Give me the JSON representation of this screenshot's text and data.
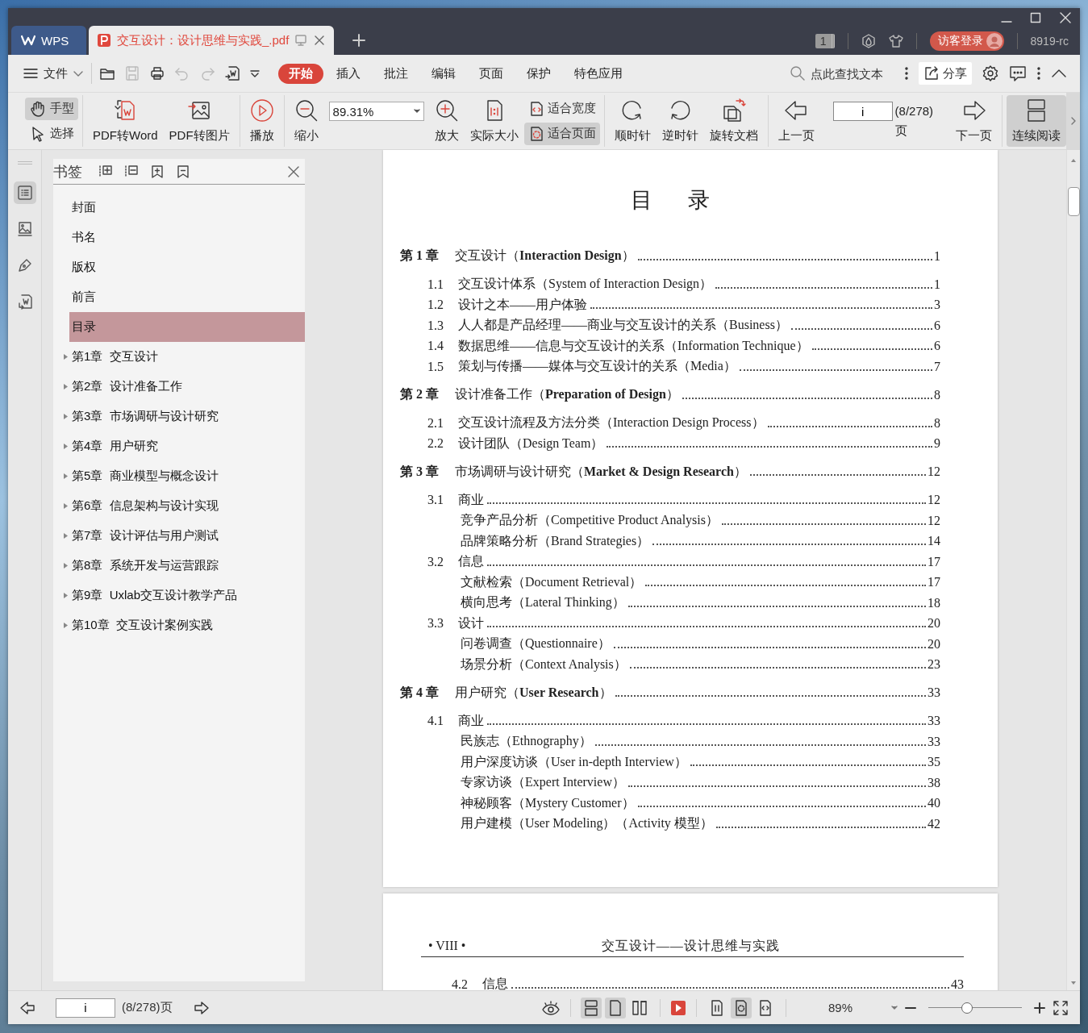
{
  "tabs": [
    {
      "kind": "home",
      "label": "WPS",
      "selected": false
    },
    {
      "kind": "document",
      "label": "交互设计：设计思维与实践_.pdf",
      "selected": true
    }
  ],
  "title_bar": {
    "badge": "1",
    "login_button": "访客登录",
    "user": "8919-rc"
  },
  "menu_bar": {
    "file_menu": "文件",
    "quick_access": [
      {
        "disabled": false
      },
      {
        "disabled": true
      },
      {
        "disabled": false
      },
      {
        "disabled": true
      },
      {
        "disabled": true
      },
      {
        "disabled": false
      }
    ],
    "tabs": [
      {
        "label": "开始",
        "selected": true
      },
      {
        "label": "插入",
        "selected": false
      },
      {
        "label": "批注",
        "selected": false
      },
      {
        "label": "编辑",
        "selected": false
      },
      {
        "label": "页面",
        "selected": false
      },
      {
        "label": "保护",
        "selected": false
      },
      {
        "label": "特色应用",
        "selected": false
      }
    ],
    "search": {
      "placeholder": "点此查找文本"
    },
    "share_button": "分享"
  },
  "toolbar": {
    "groups": [
      [
        {
          "kind": "pair",
          "buttons": [
            {
              "label": "手型",
              "selected": true
            },
            {
              "label": "选择",
              "selected": false
            }
          ]
        }
      ],
      [
        {
          "kind": "button",
          "label": "PDF转Word"
        },
        {
          "kind": "button",
          "label": "PDF转图片"
        }
      ],
      [
        {
          "kind": "button",
          "label": "播放"
        }
      ],
      [
        {
          "kind": "button",
          "label": "缩小"
        },
        {
          "kind": "zoom",
          "value": "89.31%"
        },
        {
          "kind": "button",
          "label": "放大"
        },
        {
          "kind": "button",
          "label": "实际大小"
        },
        {
          "kind": "pair",
          "buttons": [
            {
              "label": "适合宽度",
              "selected": false
            },
            {
              "label": "适合页面",
              "selected": true
            }
          ]
        }
      ],
      [
        {
          "kind": "button",
          "label": "顺时针"
        },
        {
          "kind": "button",
          "label": "逆时针"
        },
        {
          "kind": "button",
          "label": "旋转文档"
        }
      ],
      [
        {
          "kind": "button",
          "label": "上一页"
        },
        {
          "kind": "page",
          "value": "i",
          "total": "(8/278)页"
        },
        {
          "kind": "button",
          "label": "下一页"
        }
      ],
      [
        {
          "kind": "toggle",
          "label": "连续阅读",
          "selected": true
        }
      ]
    ]
  },
  "sidebar": {
    "rail": [
      {
        "selected": true
      },
      {
        "selected": false
      },
      {
        "selected": false
      },
      {
        "selected": false
      }
    ],
    "bookmarks": {
      "title": "书签",
      "items": [
        {
          "kind": "leaf",
          "label": "封面",
          "selected": false
        },
        {
          "kind": "leaf",
          "label": "书名",
          "selected": false
        },
        {
          "kind": "leaf",
          "label": "版权",
          "selected": false
        },
        {
          "kind": "leaf",
          "label": "前言",
          "selected": false
        },
        {
          "kind": "leaf",
          "label": "目录",
          "selected": true
        },
        {
          "kind": "branch",
          "label": "第1章  交互设计",
          "selected": false,
          "expanded": false
        },
        {
          "kind": "branch",
          "label": "第2章  设计准备工作",
          "selected": false,
          "expanded": false
        },
        {
          "kind": "branch",
          "label": "第3章  市场调研与设计研究",
          "selected": false,
          "expanded": false
        },
        {
          "kind": "branch",
          "label": "第4章  用户研究",
          "selected": false,
          "expanded": false
        },
        {
          "kind": "branch",
          "label": "第5章  商业模型与概念设计",
          "selected": false,
          "expanded": false
        },
        {
          "kind": "branch",
          "label": "第6章  信息架构与设计实现",
          "selected": false,
          "expanded": false
        },
        {
          "kind": "branch",
          "label": "第7章  设计评估与用户测试",
          "selected": false,
          "expanded": false
        },
        {
          "kind": "branch",
          "label": "第8章  系统开发与运营跟踪",
          "selected": false,
          "expanded": false
        },
        {
          "kind": "branch",
          "label": "第9章  Uxlab交互设计教学产品",
          "selected": false,
          "expanded": false
        },
        {
          "kind": "branch",
          "label": "第10章  交互设计案例实践",
          "selected": false,
          "expanded": false
        }
      ]
    }
  },
  "document": {
    "pages": [
      {
        "title": "目录",
        "toc": [
          {
            "kind": "chapter",
            "number": "第 1 章",
            "title": "交互设计（**Interaction Design**）",
            "page": "1",
            "children": [
              {
                "kind": "section",
                "number": "1.1",
                "title": "交互设计体系（System of Interaction Design）",
                "page": "1"
              },
              {
                "kind": "section",
                "number": "1.2",
                "title": "设计之本——用户体验",
                "page": "3"
              },
              {
                "kind": "section",
                "number": "1.3",
                "title": "人人都是产品经理——商业与交互设计的关系（Business）",
                "page": "6"
              },
              {
                "kind": "section",
                "number": "1.4",
                "title": "数据思维——信息与交互设计的关系（Information Technique）",
                "page": "6"
              },
              {
                "kind": "section",
                "number": "1.5",
                "title": "策划与传播——媒体与交互设计的关系（Media）",
                "page": "7"
              }
            ]
          },
          {
            "kind": "chapter",
            "number": "第 2 章",
            "title": "设计准备工作（**Preparation of Design**）",
            "page": "8",
            "children": [
              {
                "kind": "section",
                "number": "2.1",
                "title": "交互设计流程及方法分类（Interaction Design Process）",
                "page": "8"
              },
              {
                "kind": "section",
                "number": "2.2",
                "title": "设计团队（Design Team）",
                "page": "9"
              }
            ]
          },
          {
            "kind": "chapter",
            "number": "第 3 章",
            "title": "市场调研与设计研究（**Market & Design Research**）",
            "page": "12",
            "children": [
              {
                "kind": "section",
                "number": "3.1",
                "title": "商业",
                "page": "12",
                "children": [
                  {
                    "kind": "topic",
                    "title": "竞争产品分析（Competitive Product Analysis）",
                    "page": "12"
                  },
                  {
                    "kind": "topic",
                    "title": "品牌策略分析（Brand Strategies）",
                    "page": "14"
                  }
                ]
              },
              {
                "kind": "section",
                "number": "3.2",
                "title": "信息",
                "page": "17",
                "children": [
                  {
                    "kind": "topic",
                    "title": "文献检索（Document Retrieval）",
                    "page": "17"
                  },
                  {
                    "kind": "topic",
                    "title": "横向思考（Lateral Thinking）",
                    "page": "18"
                  }
                ]
              },
              {
                "kind": "section",
                "number": "3.3",
                "title": "设计",
                "page": "20",
                "children": [
                  {
                    "kind": "topic",
                    "title": "问卷调查（Questionnaire）",
                    "page": "20"
                  },
                  {
                    "kind": "topic",
                    "title": "场景分析（Context Analysis）",
                    "page": "23"
                  }
                ]
              }
            ]
          },
          {
            "kind": "chapter",
            "number": "第 4 章",
            "title": "用户研究（**User Research**）",
            "page": "33",
            "children": [
              {
                "kind": "section",
                "number": "4.1",
                "title": "商业",
                "page": "33",
                "children": [
                  {
                    "kind": "topic",
                    "title": "民族志（Ethnography）",
                    "page": "33"
                  },
                  {
                    "kind": "topic",
                    "title": "用户深度访谈（User in-depth Interview）",
                    "page": "35"
                  },
                  {
                    "kind": "topic",
                    "title": "专家访谈（Expert Interview）",
                    "page": "38"
                  },
                  {
                    "kind": "topic",
                    "title": "神秘顾客（Mystery Customer）",
                    "page": "40"
                  },
                  {
                    "kind": "topic",
                    "title": "用户建模（User Modeling）（Activity 模型）",
                    "page": "42"
                  }
                ]
              }
            ]
          }
        ]
      },
      {
        "header": {
          "page_label": "• VIII •",
          "book_title": "交互设计——设计思维与实践"
        },
        "toc": [
          {
            "kind": "section",
            "number": "4.2",
            "title": "信息",
            "page": "43"
          }
        ]
      }
    ]
  },
  "status_bar": {
    "page_field": "i",
    "page_total": "(8/278)页",
    "view_modes": [
      {
        "selected": true
      },
      {
        "selected": true
      },
      {
        "selected": false
      }
    ],
    "fit_modes": [
      {
        "selected": false
      },
      {
        "selected": true
      },
      {
        "selected": false
      }
    ],
    "zoom": "89%",
    "zoom_slider": {
      "level": 0.41
    }
  }
}
